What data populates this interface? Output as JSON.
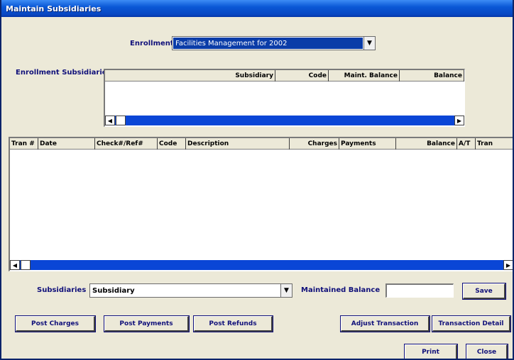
{
  "window": {
    "title": "Maintain Subsidiaries"
  },
  "enrollment": {
    "label": "Enrollment",
    "selected": "Facilities Management for 2002"
  },
  "subsidiaries_grid": {
    "label": "Enrollment Subsidiaries",
    "columns": [
      "Subsidiary",
      "Code",
      "Maint. Balance",
      "Balance"
    ]
  },
  "transactions_grid": {
    "columns": [
      "Tran #",
      "Date",
      "Check#/Ref#",
      "Code",
      "Description",
      "Charges",
      "Payments",
      "Balance",
      "A/T",
      "Tran"
    ]
  },
  "subsidiary_select": {
    "label": "Subsidiaries",
    "selected": "Subsidiary"
  },
  "maintained_balance": {
    "label": "Maintained Balance",
    "value": ""
  },
  "buttons": {
    "save": "Save",
    "post_charges": "Post Charges",
    "post_payments": "Post Payments",
    "post_refunds": "Post Refunds",
    "adjust_transaction": "Adjust Transaction",
    "transaction_detail": "Transaction Detail",
    "print": "Print",
    "close": "Close"
  },
  "colors": {
    "title_bar": "#0a58d6",
    "scrollbar": "#0a46d6",
    "label_text": "#10107a",
    "face": "#ece9d8"
  }
}
